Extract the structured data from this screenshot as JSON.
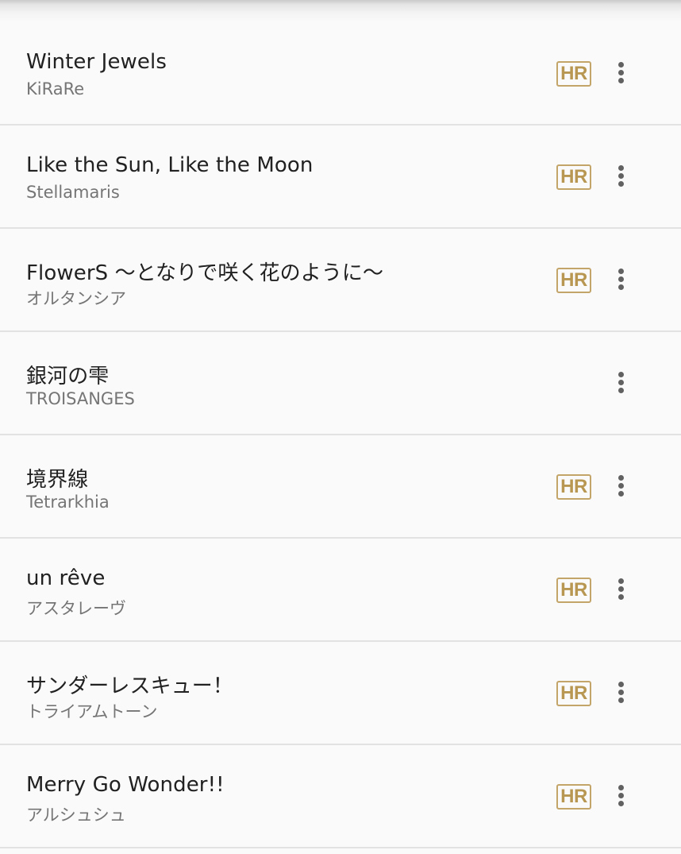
{
  "songs": [
    {
      "title": "Winter Jewels",
      "artist": "KiRaRe",
      "badge": "HR"
    },
    {
      "title": "Like the Sun, Like the Moon",
      "artist": "Stellamaris",
      "badge": "HR"
    },
    {
      "title": "FlowerS 〜となりで咲く花のように〜",
      "artist": "オルタンシア",
      "badge": "HR"
    },
    {
      "title": "銀河の雫",
      "artist": "TROISANGES",
      "badge": null
    },
    {
      "title": "境界線",
      "artist": "Tetrarkhia",
      "badge": "HR"
    },
    {
      "title": "un rêve",
      "artist": "アスタレーヴ",
      "badge": "HR"
    },
    {
      "title": "サンダーレスキュー！",
      "artist": "トライアムトーン",
      "badge": "HR"
    },
    {
      "title": "Merry Go Wonder!!",
      "artist": "アルシュシュ",
      "badge": "HR"
    }
  ],
  "icons": {
    "menu": "more-vert-icon"
  },
  "colors": {
    "background": "#fafafa",
    "divider": "#e2e2e2",
    "title": "#212121",
    "artist": "#757575",
    "badge": "#b89752",
    "menu_dots": "#616161"
  }
}
